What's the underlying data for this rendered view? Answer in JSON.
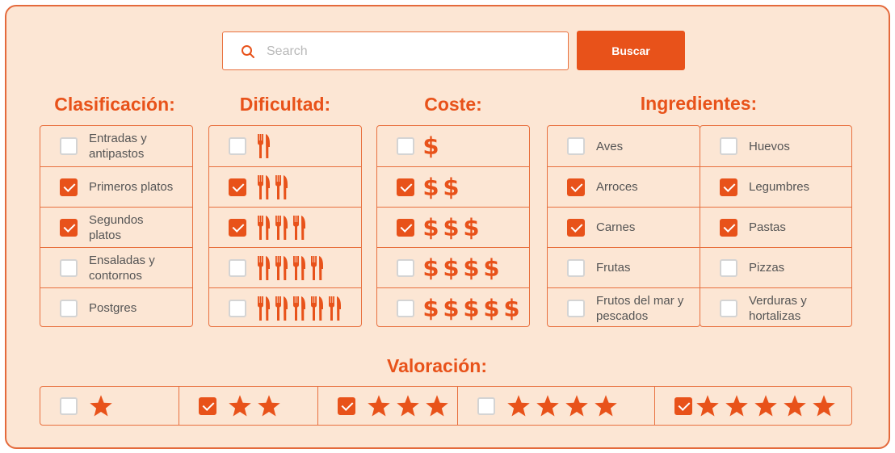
{
  "search": {
    "placeholder": "Search",
    "value": "",
    "button_label": "Buscar"
  },
  "colors": {
    "accent": "#e8521a",
    "panel_bg": "#fce6d4",
    "border": "#e8703e"
  },
  "headings": {
    "clasificacion": "Clasificación:",
    "dificultad": "Dificultad:",
    "coste": "Coste:",
    "ingredientes": "Ingredientes:",
    "valoracion": "Valoración:"
  },
  "clasificacion": [
    {
      "label": "Entradas y antipastos",
      "checked": false
    },
    {
      "label": "Primeros platos",
      "checked": true
    },
    {
      "label": "Segundos platos",
      "checked": true
    },
    {
      "label": "Ensaladas y contornos",
      "checked": false
    },
    {
      "label": "Postgres",
      "checked": false
    }
  ],
  "dificultad": [
    {
      "level": 1,
      "icon": "fork-knife-icon",
      "checked": false
    },
    {
      "level": 2,
      "icon": "fork-knife-icon",
      "checked": true
    },
    {
      "level": 3,
      "icon": "fork-knife-icon",
      "checked": true
    },
    {
      "level": 4,
      "icon": "fork-knife-icon",
      "checked": false
    },
    {
      "level": 5,
      "icon": "fork-knife-icon",
      "checked": false
    }
  ],
  "coste": [
    {
      "symbols": "$",
      "checked": false
    },
    {
      "symbols": "$$",
      "checked": true
    },
    {
      "symbols": "$$$",
      "checked": true
    },
    {
      "symbols": "$$$$",
      "checked": false
    },
    {
      "symbols": "$$$$$",
      "checked": false
    }
  ],
  "ingredientes_col1": [
    {
      "label": "Aves",
      "checked": false
    },
    {
      "label": "Arroces",
      "checked": true
    },
    {
      "label": "Carnes",
      "checked": true
    },
    {
      "label": "Frutas",
      "checked": false
    },
    {
      "label": "Frutos del mar y pescados",
      "checked": false
    }
  ],
  "ingredientes_col2": [
    {
      "label": "Huevos",
      "checked": false
    },
    {
      "label": "Legumbres",
      "checked": true
    },
    {
      "label": "Pastas",
      "checked": true
    },
    {
      "label": "Pizzas",
      "checked": false
    },
    {
      "label": "Verduras y hortalizas",
      "checked": false
    }
  ],
  "valoracion": [
    {
      "stars": 1,
      "icon": "star-icon",
      "checked": false
    },
    {
      "stars": 2,
      "icon": "star-icon",
      "checked": true
    },
    {
      "stars": 3,
      "icon": "star-icon",
      "checked": true
    },
    {
      "stars": 4,
      "icon": "star-icon",
      "checked": false
    },
    {
      "stars": 5,
      "icon": "star-icon",
      "checked": true
    }
  ]
}
